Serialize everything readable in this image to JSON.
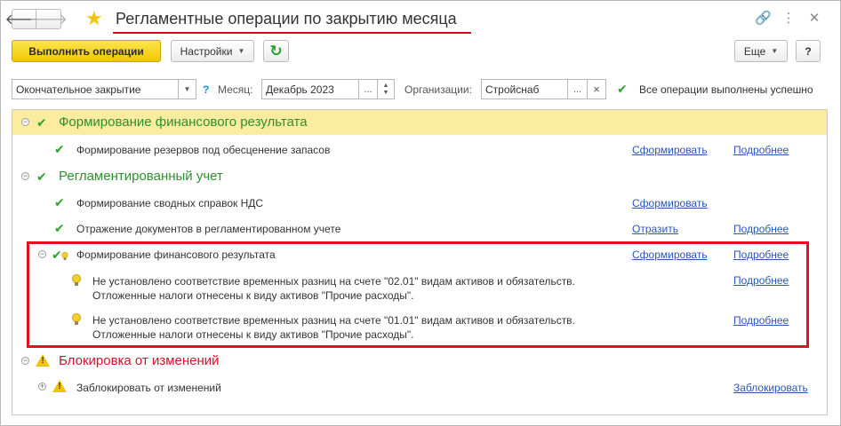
{
  "window": {
    "title": "Регламентные операции по закрытию месяца",
    "back_icon": "🡐",
    "forward_icon": "🡒",
    "link_icon": "🔗",
    "menu_icon": "⋮",
    "close_icon": "✕"
  },
  "toolbar": {
    "run_label": "Выполнить операции",
    "settings_label": "Настройки",
    "refresh_icon": "↻",
    "more_label": "Еще",
    "help_label": "?"
  },
  "filters": {
    "closing_type": "Окончательное закрытие",
    "help_q": "?",
    "month_label": "Месяц:",
    "month_value": "Декабрь 2023",
    "org_label": "Организации:",
    "org_value": "Стройснаб",
    "ellipsis": "...",
    "clear": "×",
    "status_text": "Все операции выполнены успешно"
  },
  "tree": {
    "group1": {
      "title": "Формирование финансового результата",
      "items": [
        {
          "label": "Формирование резервов под обесценение запасов",
          "action": "Сформировать",
          "details": "Подробнее"
        }
      ]
    },
    "group2": {
      "title": "Регламентированный учет",
      "items": [
        {
          "label": "Формирование сводных справок НДС",
          "action": "Сформировать"
        },
        {
          "label": "Отражение документов в регламентированном учете",
          "action": "Отразить",
          "details": "Подробнее"
        },
        {
          "label": "Формирование финансового результата",
          "action": "Сформировать",
          "details": "Подробнее"
        }
      ],
      "messages": [
        {
          "line1": "Не установлено соответствие временных разниц на счете \"02.01\" видам активов и обязательств.",
          "line2": "Отложенные налоги отнесены к виду активов \"Прочие расходы\".",
          "details": "Подробнее"
        },
        {
          "line1": "Не установлено соответствие временных разниц на счете \"01.01\" видам активов и обязательств.",
          "line2": "Отложенные налоги отнесены к виду активов \"Прочие расходы\".",
          "details": "Подробнее"
        }
      ]
    },
    "group3": {
      "title": "Блокировка от изменений",
      "items": [
        {
          "label": "Заблокировать от изменений",
          "action": "Заблокировать"
        }
      ]
    }
  },
  "colors": {
    "accent_green": "#2e8f2e",
    "accent_red": "#d8102c",
    "link_blue": "#2a56b5",
    "highlight_row": "#fbec9f",
    "primary_button": "#f0c800"
  }
}
